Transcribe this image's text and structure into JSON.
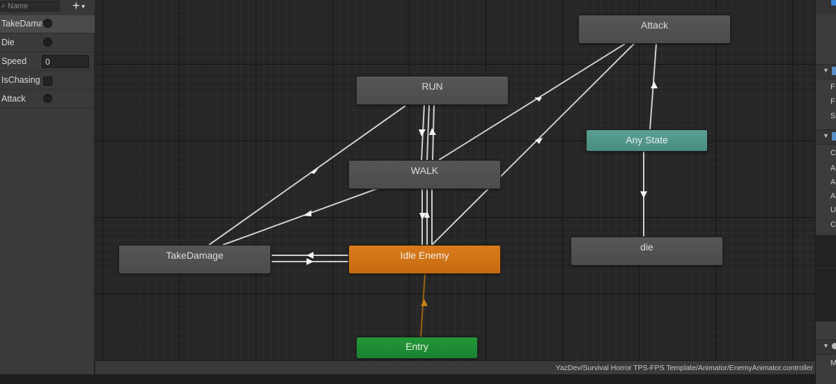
{
  "parameters": {
    "search_placeholder": "Name",
    "add_label": "+",
    "items": [
      {
        "name": "TakeDamage",
        "type": "trigger",
        "selected": true
      },
      {
        "name": "Die",
        "type": "trigger"
      },
      {
        "name": "Speed",
        "type": "float",
        "value": "0"
      },
      {
        "name": "IsChasing",
        "type": "bool"
      },
      {
        "name": "Attack",
        "type": "trigger"
      }
    ]
  },
  "graph": {
    "states": {
      "attack": "Attack",
      "run": "RUN",
      "walk": "WALK",
      "any_state": "Any State",
      "take_damage": "TakeDamage",
      "idle_enemy": "Idle Enemy",
      "die": "die",
      "entry": "Entry"
    },
    "colors": {
      "normal_state": "#515254",
      "default_state": "#d07316",
      "entry_state": "#1f8c34",
      "any_state": "#529689",
      "transition": "#cfcfcf",
      "entry_transition": "#9c6412"
    }
  },
  "footer": {
    "path": "YazDev/Survival Horror TPS-FPS Template/Animator/EnemyAnimator.controller"
  },
  "inspector": {
    "letters": [
      "F",
      "F",
      "S",
      "C",
      "A",
      "A",
      "A",
      "U",
      "C",
      "M"
    ]
  }
}
